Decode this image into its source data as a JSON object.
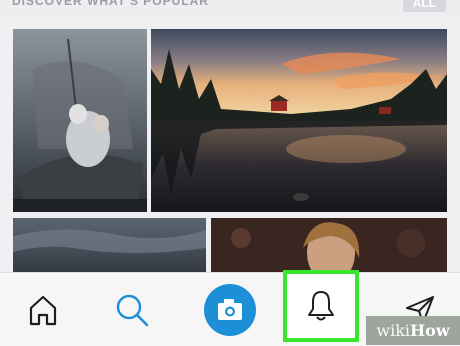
{
  "header": {
    "section_title": "DISCOVER WHAT'S POPULAR",
    "see_all_label": "ALL"
  },
  "grid": [
    {
      "subject": "boat-scene"
    },
    {
      "subject": "lake-sunset"
    },
    {
      "subject": "stormy-sky"
    },
    {
      "subject": "portrait"
    }
  ],
  "tabbar": {
    "items": [
      {
        "icon": "home-icon"
      },
      {
        "icon": "search-icon"
      },
      {
        "icon": "camera-icon"
      },
      {
        "icon": "bell-icon",
        "highlighted": true
      },
      {
        "icon": "send-icon"
      }
    ],
    "accent": "#1d8fd6",
    "highlight_color": "#38e62d"
  },
  "watermark": {
    "part1": "wiki",
    "part2": "How"
  }
}
